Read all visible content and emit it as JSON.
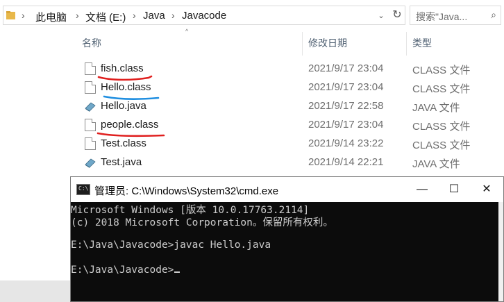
{
  "explorer": {
    "breadcrumb": [
      "此电脑",
      "文档 (E:)",
      "Java",
      "Javacode"
    ],
    "search_placeholder": "搜索\"Java...",
    "columns": {
      "name": "名称",
      "date": "修改日期",
      "type": "类型"
    },
    "files": [
      {
        "name": "fish.class",
        "date": "2021/9/17 23:04",
        "type": "CLASS 文件",
        "icon": "class-file-icon",
        "underline": "#e0201f"
      },
      {
        "name": "Hello.class",
        "date": "2021/9/17 23:04",
        "type": "CLASS 文件",
        "icon": "class-file-icon",
        "underline": "#1f8ee0"
      },
      {
        "name": "Hello.java",
        "date": "2021/9/17 22:58",
        "type": "JAVA 文件",
        "icon": "java-file-icon"
      },
      {
        "name": "people.class",
        "date": "2021/9/17 23:04",
        "type": "CLASS 文件",
        "icon": "class-file-icon",
        "underline": "#e0201f"
      },
      {
        "name": "Test.class",
        "date": "2021/9/14 23:22",
        "type": "CLASS 文件",
        "icon": "class-file-icon"
      },
      {
        "name": "Test.java",
        "date": "2021/9/14 22:21",
        "type": "JAVA 文件",
        "icon": "java-file-icon"
      }
    ]
  },
  "cmd": {
    "title": "管理员: C:\\Windows\\System32\\cmd.exe",
    "icon_label": "C:\\",
    "controls": {
      "minimize": "—",
      "maximize": "☐",
      "close": "✕"
    },
    "lines": [
      "Microsoft Windows [版本 10.0.17763.2114]",
      "(c) 2018 Microsoft Corporation。保留所有权利。",
      "",
      "E:\\Java\\Javacode>javac Hello.java",
      "",
      "E:\\Java\\Javacode>"
    ]
  }
}
